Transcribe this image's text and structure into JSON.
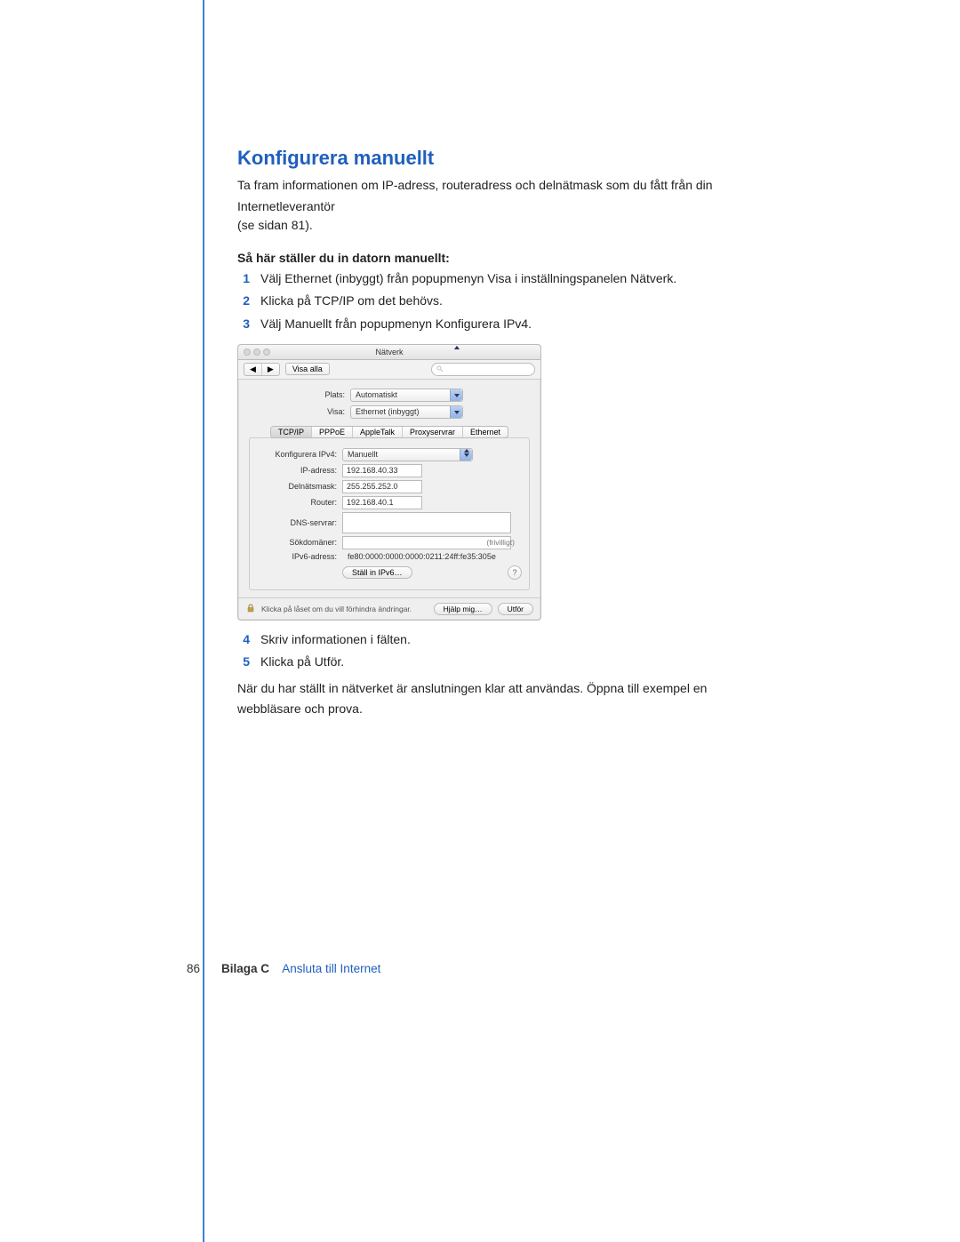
{
  "title": "Konfigurera manuellt",
  "intro_line1": "Ta fram informationen om IP-adress, routeradress och delnätmask som du fått från din",
  "intro_line2": "Internetleverantör",
  "intro_line3": "(se sidan 81).",
  "subheading": "Så här ställer du in datorn manuellt:",
  "steps": {
    "s1": "Välj Ethernet (inbyggt) från popupmenyn Visa i inställningspanelen Nätverk.",
    "s2": "Klicka på TCP/IP om det behövs.",
    "s3": "Välj Manuellt från popupmenyn Konfigurera IPv4.",
    "s4": "Skriv informationen i fälten.",
    "s5": "Klicka på Utför."
  },
  "pane": {
    "window_title": "Nätverk",
    "show_all_label": "Visa alla",
    "location_label": "Plats:",
    "show_label": "Visa:",
    "location_value": "Automatiskt",
    "show_value": "Ethernet (inbyggt)",
    "tabs": [
      "TCP/IP",
      "PPPoE",
      "AppleTalk",
      "Proxyservrar",
      "Ethernet"
    ],
    "labels": {
      "configure": "Konfigurera IPv4:",
      "ip": "IP-adress:",
      "subnet": "Delnätsmask:",
      "router": "Router:",
      "dns": "DNS-servrar:",
      "search": "Sökdomäner:",
      "ipv6": "IPv6-adress:"
    },
    "values": {
      "configure": "Manuellt",
      "ip": "192.168.40.33",
      "subnet": "255.255.252.0",
      "router": "192.168.40.1",
      "dns": "",
      "search": "",
      "ipv6": "fe80:0000:0000:0000:0211:24ff:fe35:305e"
    },
    "optional_hint": "(frivilligt)",
    "ipv6_button": "Ställ in IPv6…",
    "lock_text": "Klicka på låset om du vill förhindra ändringar.",
    "help_button": "Hjälp mig…",
    "apply_button": "Utför"
  },
  "after_steps_line1": "När du har ställt in nätverket är anslutningen klar att användas. Öppna till exempel en",
  "after_steps_line2": "webbläsare och prova.",
  "footer": {
    "page_number": "86",
    "appendix": "Bilaga C",
    "appendix_name": "Ansluta till Internet"
  }
}
